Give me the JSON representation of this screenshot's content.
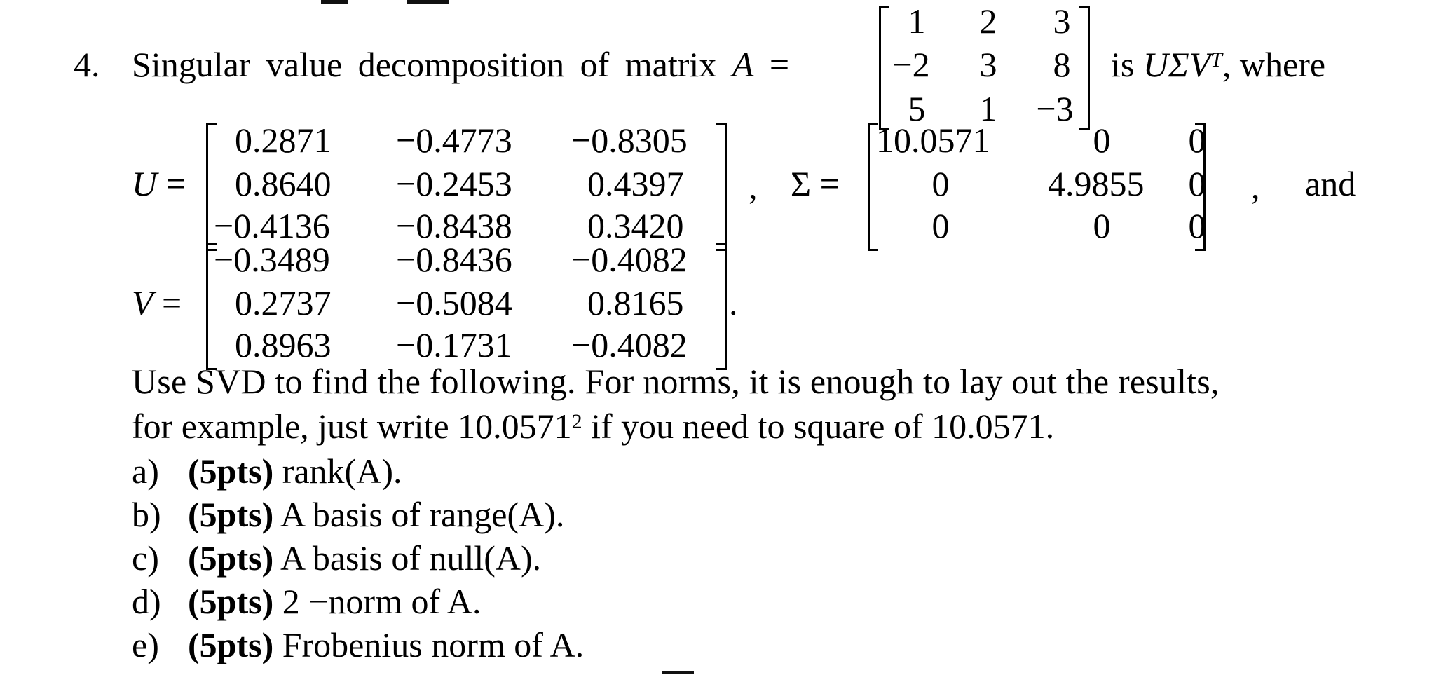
{
  "problem": {
    "number": "4.",
    "intro": "Singular value decomposition of matrix",
    "A_symbol": "A",
    "equals": "=",
    "is_text": "is",
    "decomposition": "UΣV",
    "transpose": "T",
    "where_text": ", where",
    "comma": ",",
    "and_text": "and",
    "period": ".",
    "matrices": {
      "A": {
        "label": "A",
        "rows": [
          [
            "1",
            "2",
            "3"
          ],
          [
            "−2",
            "3",
            "8"
          ],
          [
            "5",
            "1",
            "−3"
          ]
        ]
      },
      "U": {
        "label": "U",
        "rows": [
          [
            "0.2871",
            "−0.4773",
            "−0.8305"
          ],
          [
            "0.8640",
            "−0.2453",
            "0.4397"
          ],
          [
            "−0.4136",
            "−0.8438",
            "0.3420"
          ]
        ]
      },
      "Sigma": {
        "label": "Σ",
        "rows": [
          [
            "10.0571",
            "0",
            "0"
          ],
          [
            "0",
            "4.9855",
            "0"
          ],
          [
            "0",
            "0",
            "0"
          ]
        ]
      },
      "V": {
        "label": "V",
        "rows": [
          [
            "−0.3489",
            "−0.8436",
            "−0.4082"
          ],
          [
            "0.2737",
            "−0.5084",
            "0.8165"
          ],
          [
            "0.8963",
            "−0.1731",
            "−0.4082"
          ]
        ]
      }
    },
    "instructions_line1": "Use SVD to find the following. For norms, it is enough to lay out the results,",
    "instructions_line2_pre": "for example, just write 10.0571",
    "instructions_line2_sup": "2",
    "instructions_line2_post": " if you need to square of 10.0571.",
    "parts": [
      {
        "letter": "a)",
        "points": "(5pts)",
        "text": "rank(A)."
      },
      {
        "letter": "b)",
        "points": "(5pts)",
        "text": "A basis of range(A)."
      },
      {
        "letter": "c)",
        "points": "(5pts)",
        "text": "A basis of null(A)."
      },
      {
        "letter": "d)",
        "points": "(5pts)",
        "text": "2 −norm of A."
      },
      {
        "letter": "e)",
        "points": "(5pts)",
        "text": "Frobenius norm of A."
      }
    ]
  }
}
